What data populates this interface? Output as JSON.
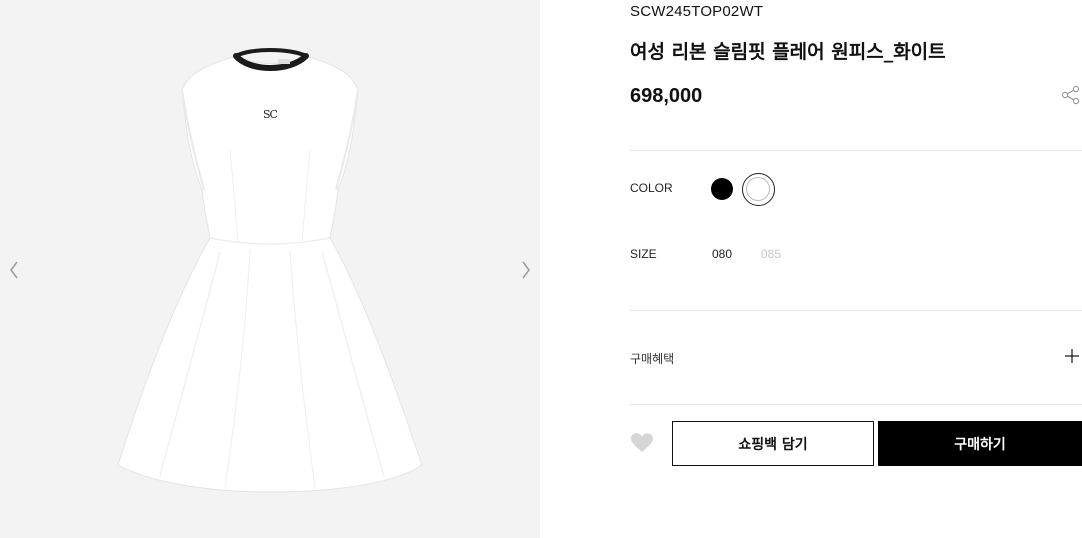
{
  "gallery": {
    "dress_logo": "SC",
    "prev_icon": "chevron-left-icon",
    "next_icon": "chevron-right-icon"
  },
  "product": {
    "sku": "SCW245TOP02WT",
    "title": "여성 리본 슬림핏 플레어 원피스_화이트",
    "price": "698,000",
    "share_icon": "share-icon"
  },
  "options": {
    "color_label": "COLOR",
    "colors": [
      {
        "name": "black",
        "hex": "#000000",
        "selected": false
      },
      {
        "name": "white",
        "hex": "#ffffff",
        "selected": true
      }
    ],
    "size_label": "SIZE",
    "sizes": [
      {
        "label": "080",
        "available": true
      },
      {
        "label": "085",
        "available": false
      }
    ]
  },
  "benefits": {
    "label": "구매혜택",
    "expand_icon": "plus-icon"
  },
  "actions": {
    "wishlist_icon": "heart-icon",
    "cart_label": "쇼핑백 담기",
    "buy_label": "구매하기"
  },
  "colors": {
    "gallery_bg": "#f3f3f3",
    "accent": "#000000",
    "disabled_text": "#c8c8c8"
  }
}
